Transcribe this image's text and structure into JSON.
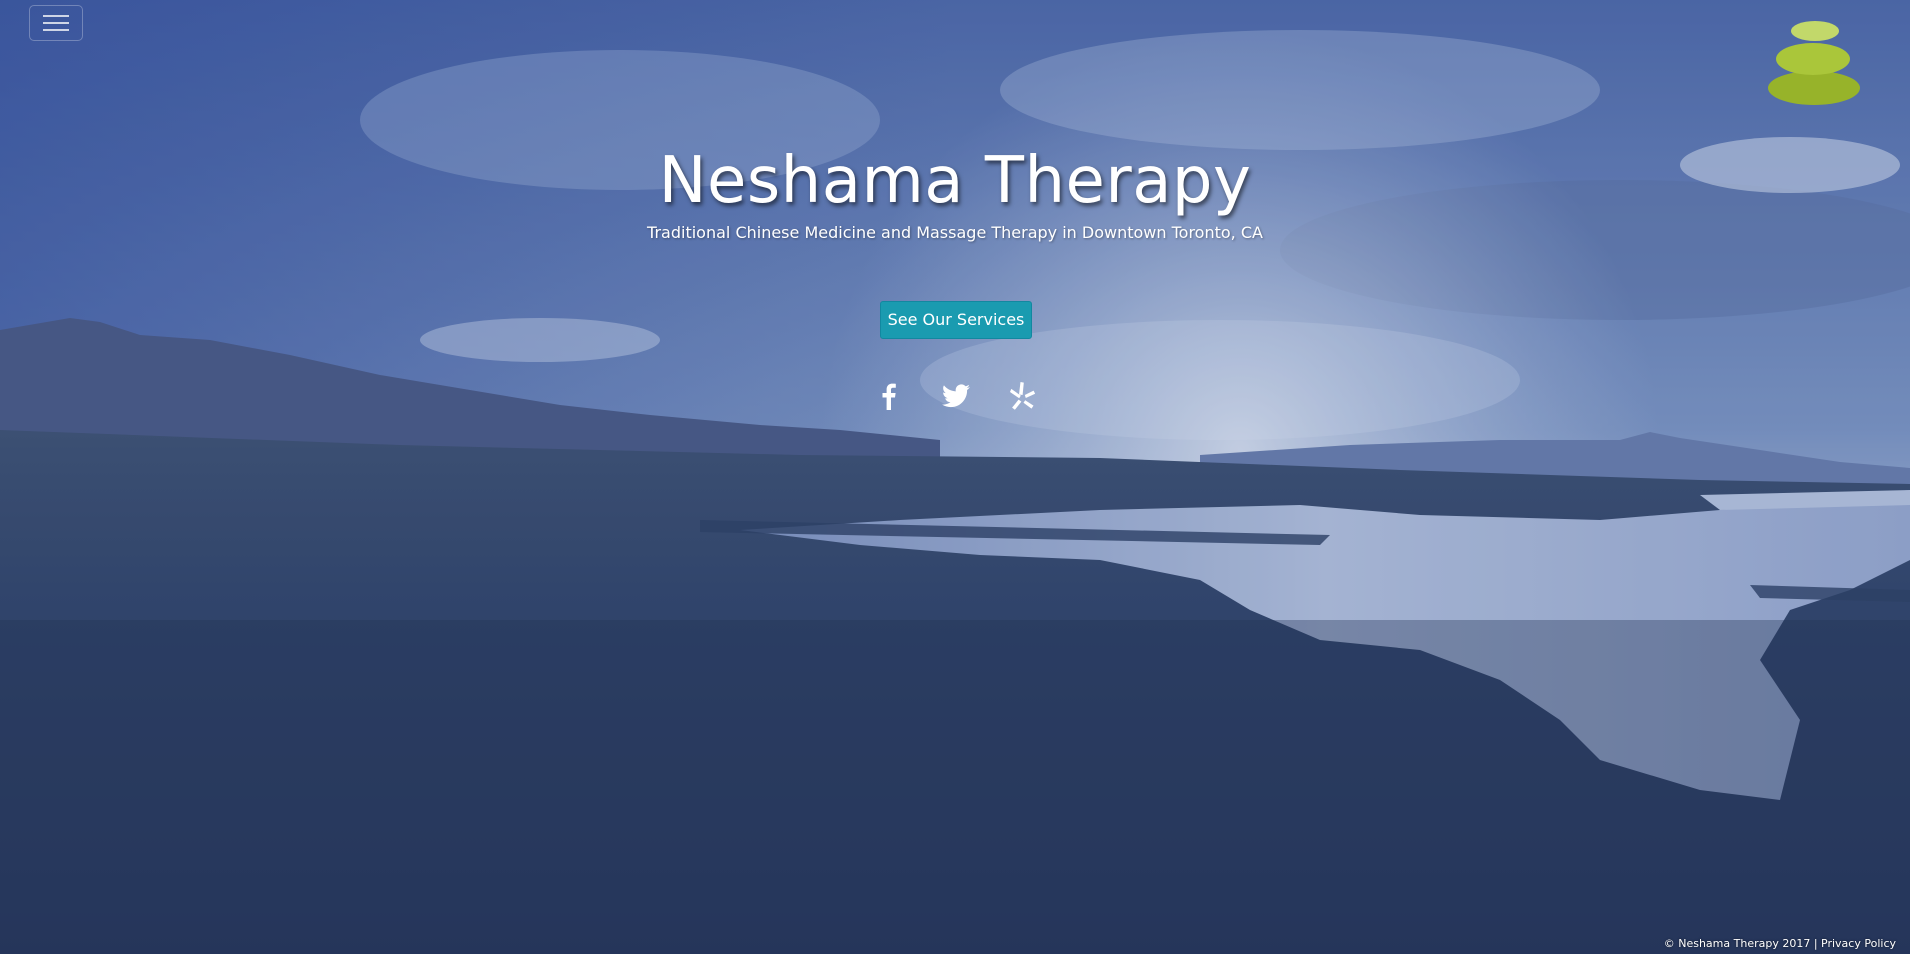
{
  "brand": {
    "title": "Neshama Therapy",
    "tagline": "Traditional Chinese Medicine and Massage Therapy in Downtown Toronto, CA",
    "logo": "stacked-stones-logo"
  },
  "nav": {
    "menu_icon": "hamburger-icon"
  },
  "hero": {
    "cta_label": "See Our Services",
    "background": "landscape-video-still-with-blue-overlay"
  },
  "socials": [
    {
      "icon": "facebook-icon"
    },
    {
      "icon": "twitter-icon"
    },
    {
      "icon": "yelp-icon"
    }
  ],
  "footer": {
    "copyright": "© Neshama Therapy 2017",
    "separator": " | ",
    "privacy_link": "Privacy Policy"
  },
  "colors": {
    "cta_background": "#1a9bb0",
    "logo_green": "#a9c52c",
    "overlay": "#2c3d66"
  }
}
